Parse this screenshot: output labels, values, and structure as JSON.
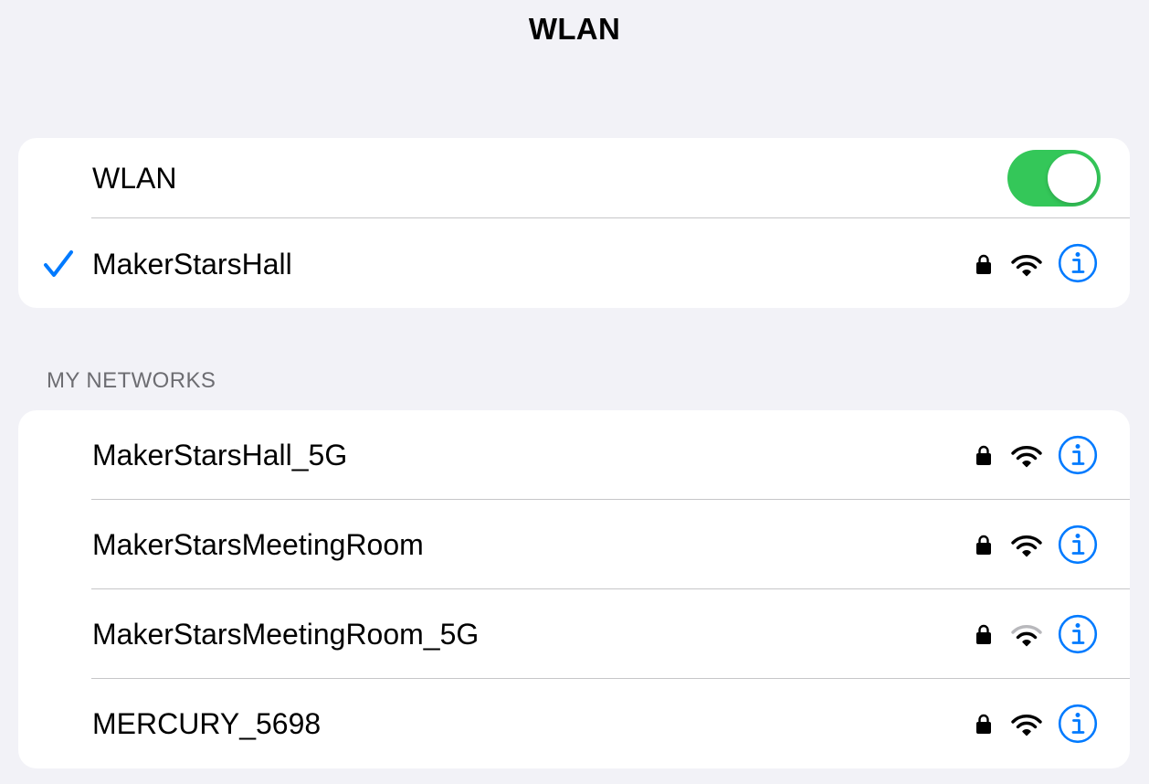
{
  "page": {
    "title": "WLAN"
  },
  "wlan_group": {
    "toggle_label": "WLAN",
    "toggle_state": "on",
    "toggle_color": "#34c759",
    "connected": {
      "name": "MakerStarsHall",
      "status_icon": "checkmark-icon",
      "secured": true,
      "signal": "strong"
    }
  },
  "my_networks": {
    "header": "MY NETWORKS",
    "items": [
      {
        "name": "MakerStarsHall_5G",
        "secured": true,
        "signal": "strong"
      },
      {
        "name": "MakerStarsMeetingRoom",
        "secured": true,
        "signal": "strong"
      },
      {
        "name": "MakerStarsMeetingRoom_5G",
        "secured": true,
        "signal": "weak"
      },
      {
        "name": "MERCURY_5698",
        "secured": true,
        "signal": "strong"
      }
    ]
  },
  "colors": {
    "accent": "#007aff",
    "background": "#f2f2f7",
    "card": "#ffffff",
    "separator": "#c6c6c8",
    "secondary_text": "#6d6d72",
    "signal_dim": "#b8b8bc"
  },
  "icons": {
    "lock": "lock-icon",
    "wifi": "wifi-icon",
    "info": "info-icon",
    "check": "checkmark-icon"
  }
}
